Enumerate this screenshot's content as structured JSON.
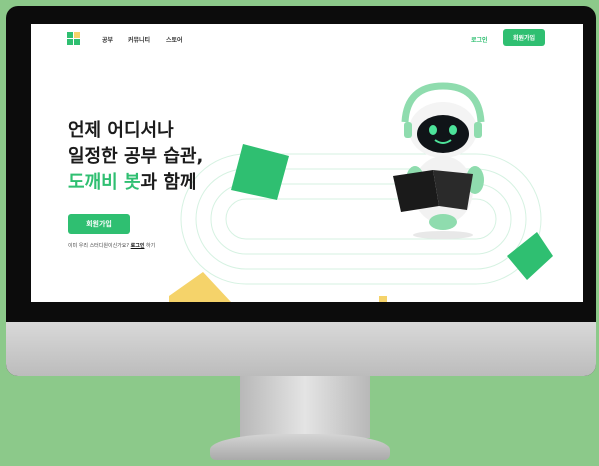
{
  "nav": {
    "items": [
      "공부",
      "커뮤니티",
      "스토어"
    ],
    "login": "로그인",
    "signup": "회원가입"
  },
  "hero": {
    "line1": "언제 어디서나",
    "line2": "일정한 공부 습관,",
    "line3_accent": "도깨비 봇",
    "line3_rest": "과 함께",
    "cta": "회원가입",
    "sub_prefix": "이미 우리 스터디원이신가요?",
    "sub_link": "로그인",
    "sub_suffix": "하기"
  },
  "colors": {
    "accent": "#2fbf71",
    "background": "#8cc98a",
    "shape_yellow": "#f5d36a"
  },
  "icons": [
    "logo-icon",
    "robot-mascot"
  ]
}
